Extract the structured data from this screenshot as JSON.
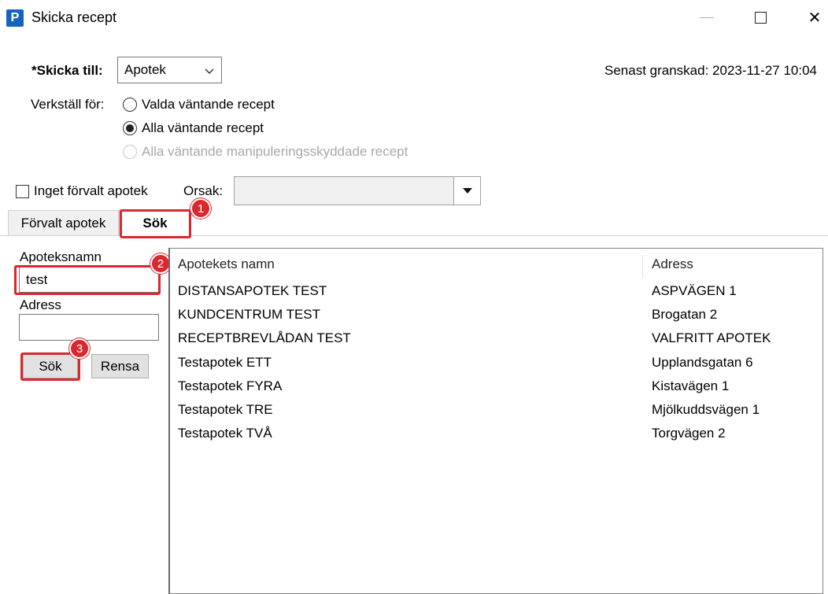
{
  "window": {
    "app_icon_letter": "P",
    "title": "Skicka recept",
    "minimize_symbol": "—",
    "close_symbol": "✕"
  },
  "send_to": {
    "label": "*Skicka till:",
    "selected": "Apotek"
  },
  "last_reviewed": "Senast granskad: 2023-11-27 10:04",
  "apply_for": {
    "label": "Verkställ för:",
    "options": [
      {
        "label": "Valda väntande recept",
        "selected": false,
        "enabled": true
      },
      {
        "label": "Alla väntande recept",
        "selected": true,
        "enabled": true
      },
      {
        "label": "Alla väntande manipuleringsskyddade recept",
        "selected": false,
        "enabled": false
      }
    ]
  },
  "no_default_pharmacy": {
    "label": "Inget förvalt apotek",
    "checked": false
  },
  "reason": {
    "label": "Orsak:",
    "value": ""
  },
  "tabs": [
    {
      "label": "Förvalt apotek",
      "active": false
    },
    {
      "label": "Sök",
      "active": true
    }
  ],
  "search": {
    "name_label": "Apoteksnamn",
    "name_value": "test",
    "address_label": "Adress",
    "address_value": "",
    "search_button": "Sök",
    "clear_button": "Rensa"
  },
  "results": {
    "columns": [
      "Apotekets namn",
      "Adress"
    ],
    "rows": [
      {
        "name": "DISTANSAPOTEK TEST",
        "address": "ASPVÄGEN 1"
      },
      {
        "name": "KUNDCENTRUM TEST",
        "address": "Brogatan 2"
      },
      {
        "name": "RECEPTBREVLÅDAN TEST",
        "address": "VALFRITT APOTEK"
      },
      {
        "name": "Testapotek ETT",
        "address": "Upplandsgatan 6"
      },
      {
        "name": "Testapotek FYRA",
        "address": "Kistavägen 1"
      },
      {
        "name": "Testapotek TRE",
        "address": "Mjölkuddsvägen 1"
      },
      {
        "name": "Testapotek TVÅ",
        "address": "Torgvägen 2"
      }
    ]
  },
  "annotations": [
    "1",
    "2",
    "3"
  ],
  "colors": {
    "highlight": "#d9282f",
    "app_icon": "#1565c0"
  }
}
